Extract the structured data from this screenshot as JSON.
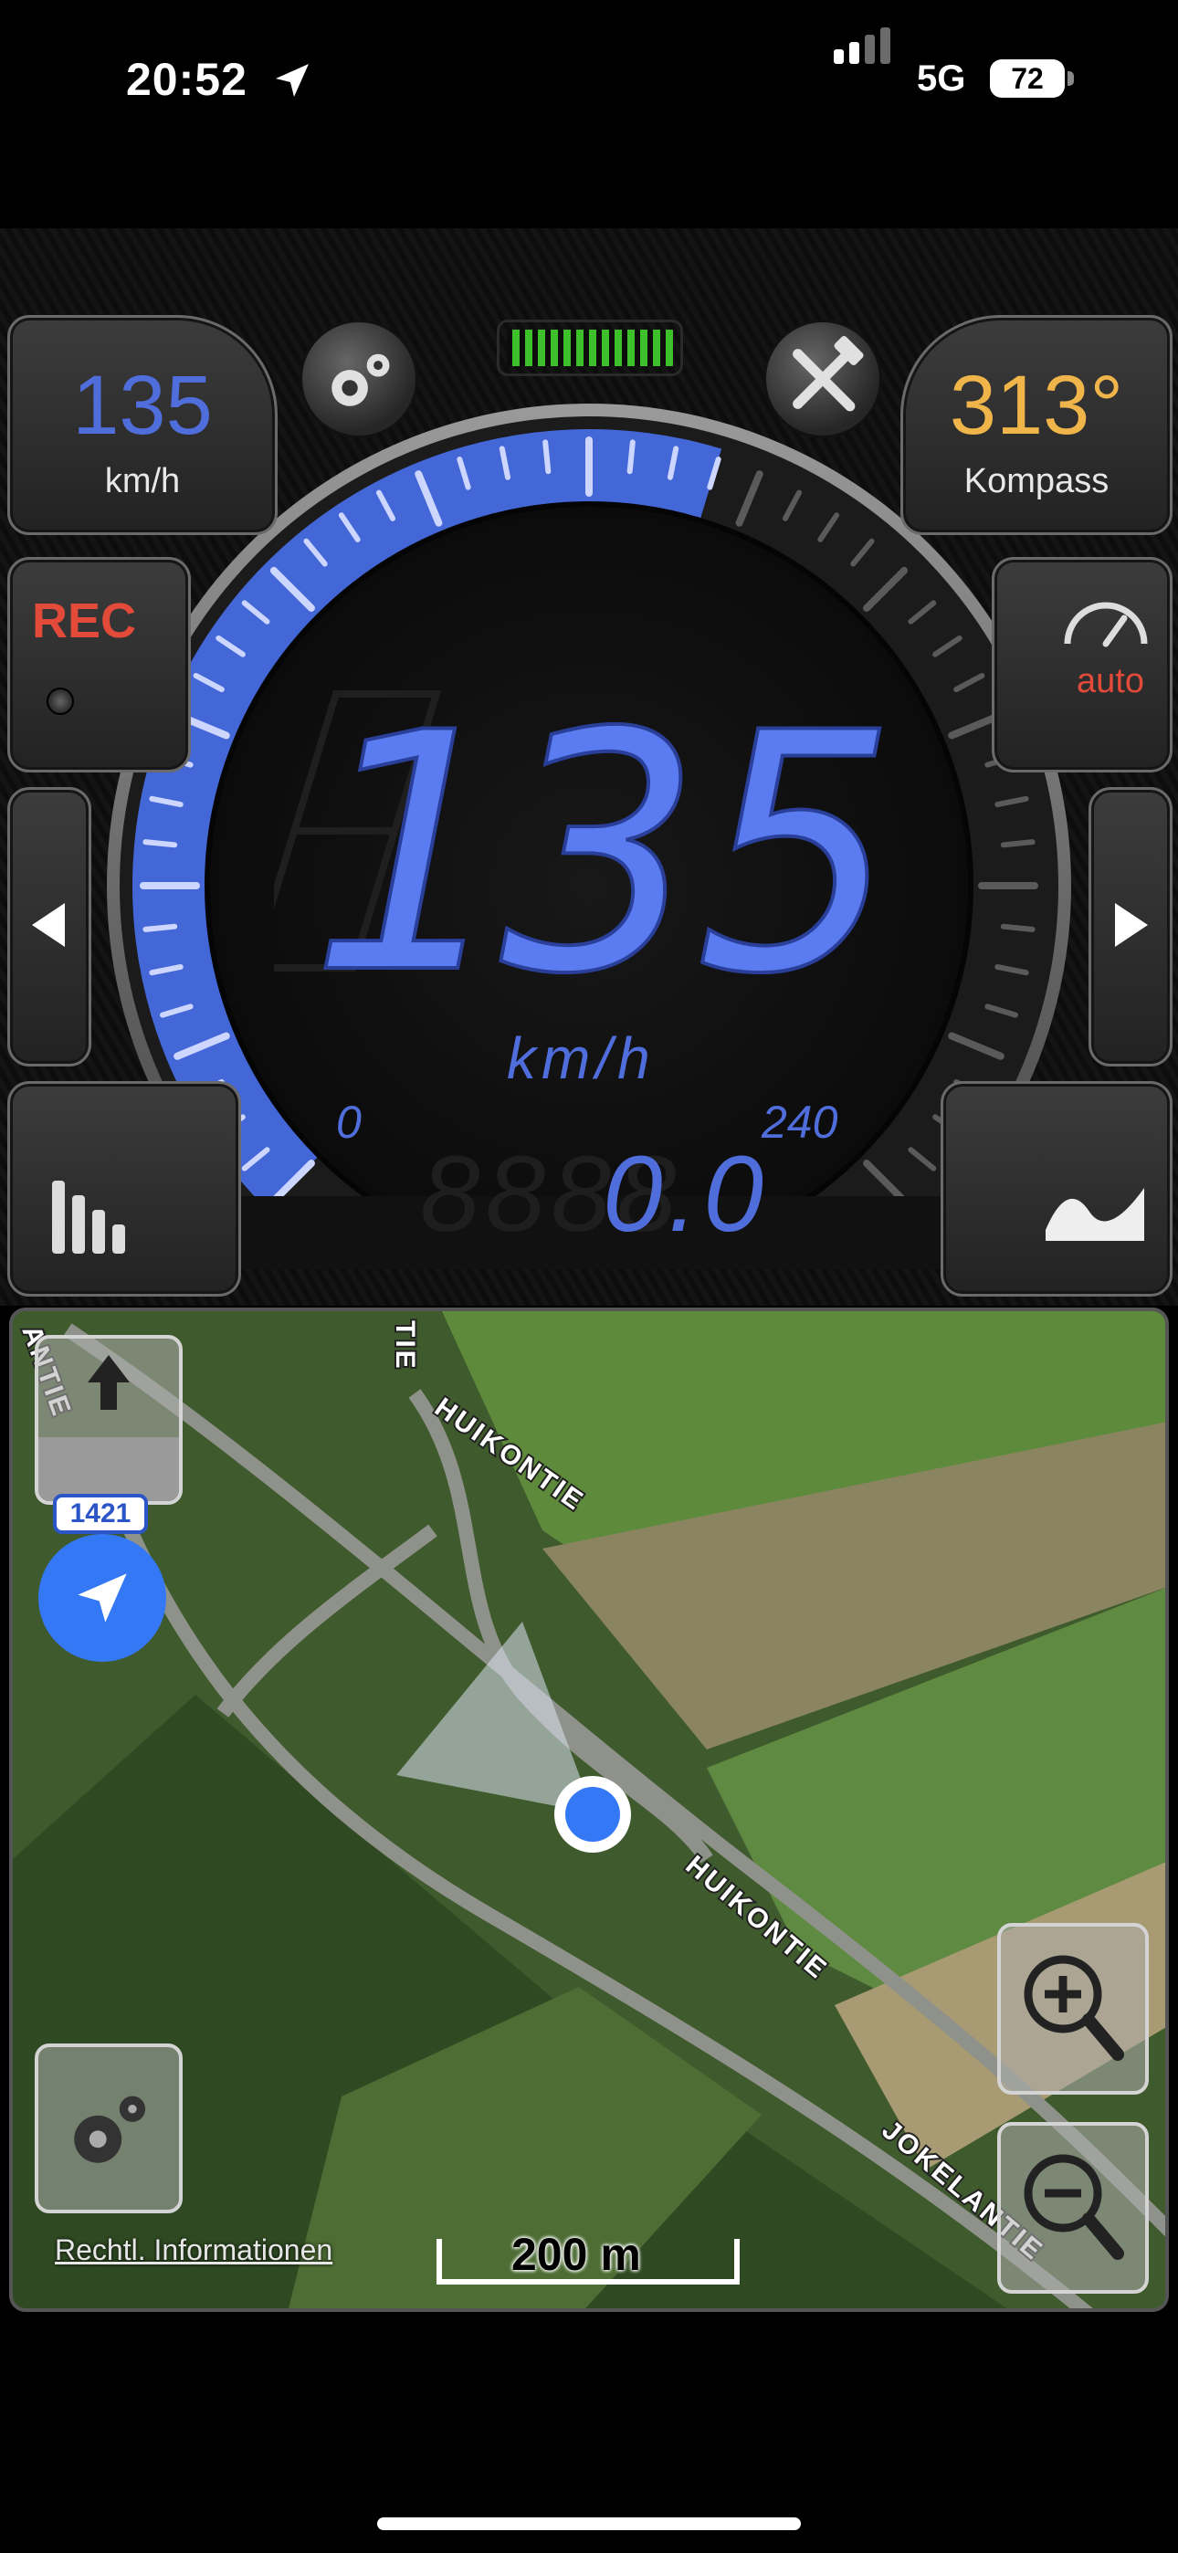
{
  "status": {
    "time": "20:52",
    "network": "5G",
    "battery": "72"
  },
  "dashboard": {
    "speed_panel": {
      "value": "135",
      "unit": "km/h"
    },
    "compass_panel": {
      "value": "313°",
      "label": "Kompass"
    },
    "rec_label": "REC",
    "auto_label": "auto",
    "gauge": {
      "speed": "135",
      "unit": "km/h",
      "min": "0",
      "max": "240",
      "trip": "0.0",
      "trip_ghost": "8888"
    },
    "colors": {
      "accent": "#4f6ddb",
      "compass": "#f0b54a",
      "rec": "#e24a3a"
    },
    "icons": {
      "settings": "gear-icon",
      "tools": "tools-icon",
      "prev": "triangle-left-icon",
      "next": "triangle-right-icon",
      "stats": "bar-chart-icon",
      "graph": "line-graph-icon",
      "speedometer": "speedometer-icon"
    }
  },
  "map": {
    "roads": [
      "HUIKONTIE",
      "HUIKONTIE",
      "JOKELANTIE",
      "ANTIE",
      "TIE"
    ],
    "route_shield": "1421",
    "legal": "Rechtl. Informationen",
    "scale": "200 m"
  }
}
